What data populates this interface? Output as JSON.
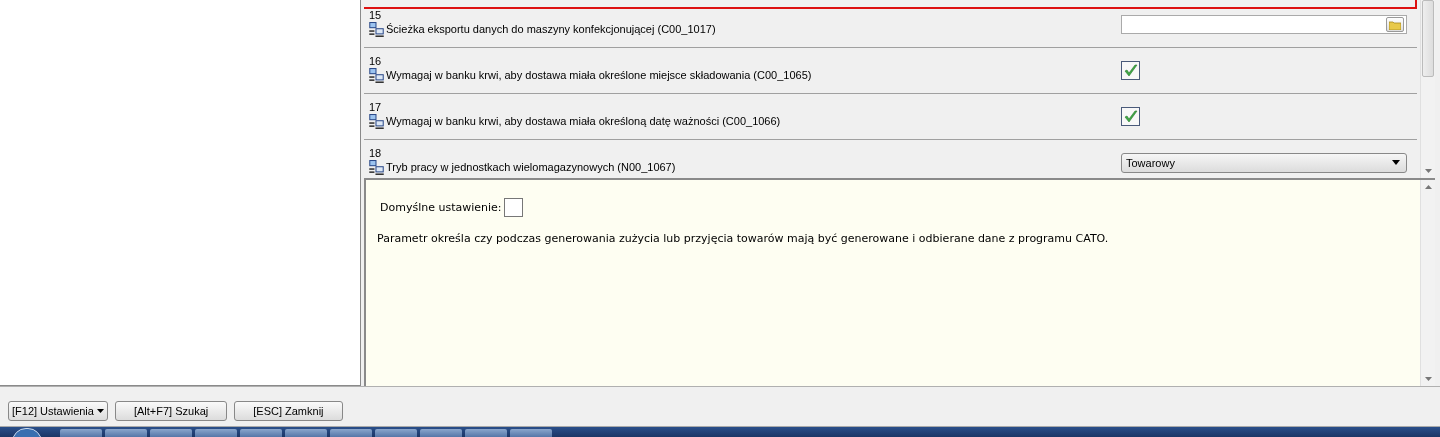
{
  "settings_list": {
    "rows": [
      {
        "selected": true
      },
      {
        "number": "15",
        "label": "Ścieżka eksportu danych do maszyny konfekcjonującej (C00_1017)",
        "kind": "path",
        "selected": false
      },
      {
        "number": "16",
        "label": "Wymagaj w banku krwi, aby dostawa miała określone miejsce składowania (C00_1065)",
        "kind": "checkbox",
        "checked": true,
        "selected": false
      },
      {
        "number": "17",
        "label": "Wymagaj w banku krwi, aby dostawa miała określoną datę ważności (C00_1066)",
        "kind": "checkbox",
        "checked": true,
        "selected": false
      },
      {
        "number": "18",
        "label": "Tryb pracy w jednostkach wielomagazynowych (N00_1067)",
        "kind": "dropdown",
        "value": "Towarowy",
        "selected": false
      }
    ]
  },
  "description": {
    "default_label": "Domyślne ustawienie:",
    "default_checked": false,
    "text": "Parametr określa czy podczas generowania zużycia lub przyjęcia towarów mają być generowane i odbierane dane z programu CATO."
  },
  "buttons": [
    {
      "label": "[F12] Ustawienia",
      "kind": "menu"
    },
    {
      "label": "[Alt+F7] Szukaj",
      "kind": "plain"
    },
    {
      "label": "[ESC] Zamknij",
      "kind": "plain"
    }
  ]
}
